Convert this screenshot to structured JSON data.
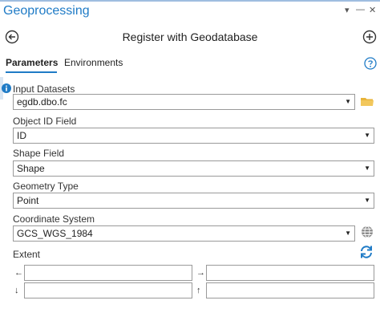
{
  "window": {
    "title": "Geoprocessing",
    "pin_glyph": "▾",
    "autohide_glyph": "—",
    "close_glyph": "✕"
  },
  "header": {
    "title": "Register with Geodatabase"
  },
  "tabs": [
    {
      "label": "Parameters",
      "active": true
    },
    {
      "label": "Environments",
      "active": false
    }
  ],
  "params": {
    "input_datasets": {
      "label": "Input Datasets",
      "value": "egdb.dbo.fc"
    },
    "object_id_field": {
      "label": "Object ID Field",
      "value": "ID"
    },
    "shape_field": {
      "label": "Shape Field",
      "value": "Shape"
    },
    "geometry_type": {
      "label": "Geometry Type",
      "value": "Point"
    },
    "coordinate_system": {
      "label": "Coordinate System",
      "value": "GCS_WGS_1984"
    },
    "extent": {
      "label": "Extent",
      "left_arrow": "←",
      "right_arrow": "→",
      "down_arrow": "↓",
      "up_arrow": "↑"
    }
  },
  "dropdown_caret": "▼",
  "colors": {
    "accent": "#1f7bc6",
    "folder": "#e8b43a"
  },
  "icons": [
    "back-icon",
    "add-icon",
    "help-icon",
    "info-icon",
    "folder-icon",
    "globe-icon",
    "refresh-icon"
  ]
}
